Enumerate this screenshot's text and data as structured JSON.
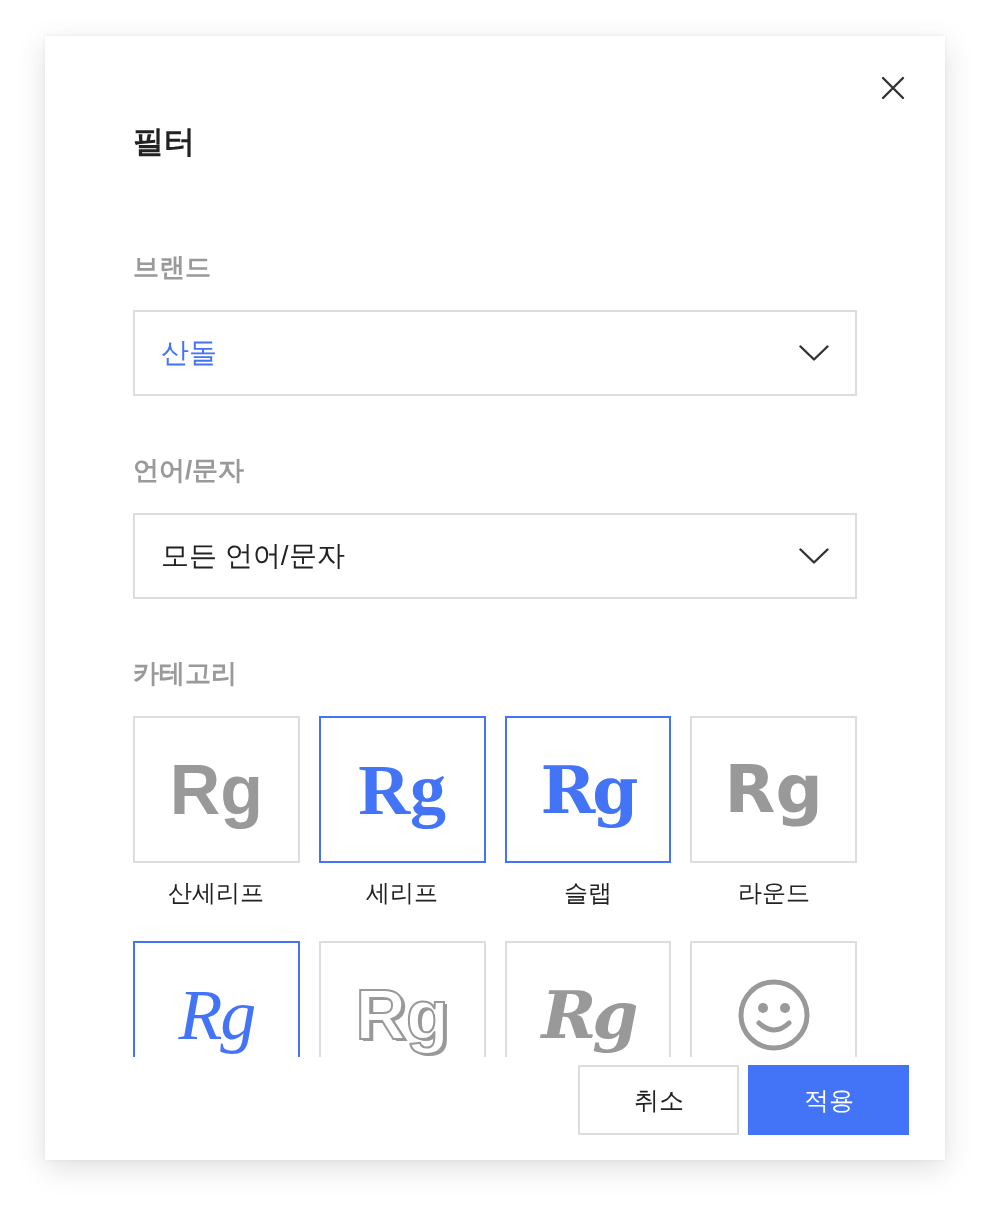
{
  "dialog": {
    "title": "필터"
  },
  "fields": [
    {
      "label": "브랜드",
      "value": "산돌",
      "chosen": true
    },
    {
      "label": "언어/문자",
      "value": "모든 언어/문자",
      "chosen": false
    }
  ],
  "categories": {
    "label": "카테고리",
    "items": [
      {
        "kind": "sans",
        "sample": "Rg",
        "label": "산세리프",
        "selected": false
      },
      {
        "kind": "serif",
        "sample": "Rg",
        "label": "세리프",
        "selected": true
      },
      {
        "kind": "slab",
        "sample": "Rg",
        "label": "슬랩",
        "selected": true
      },
      {
        "kind": "round",
        "sample": "Rg",
        "label": "라운드",
        "selected": false
      },
      {
        "kind": "script",
        "sample": "Rg",
        "selected": true
      },
      {
        "kind": "inline",
        "sample": "Rg",
        "selected": false
      },
      {
        "kind": "blackletter",
        "sample": "Rg",
        "selected": false
      },
      {
        "kind": "emoji",
        "selected": false
      }
    ]
  },
  "buttons": [
    {
      "kind": "secondary",
      "label": "취소"
    },
    {
      "kind": "primary",
      "label": "적용"
    }
  ]
}
